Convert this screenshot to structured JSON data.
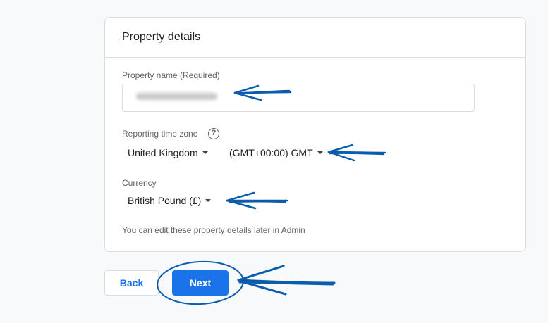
{
  "card": {
    "title": "Property details"
  },
  "property_name": {
    "label": "Property name (Required)",
    "value": ""
  },
  "time_zone": {
    "label": "Reporting time zone",
    "help_icon": "help-circle-icon",
    "country": "United Kingdom",
    "zone": "(GMT+00:00) GMT"
  },
  "currency": {
    "label": "Currency",
    "value": "British Pound (£)"
  },
  "note": "You can edit these property details later in Admin",
  "buttons": {
    "back": "Back",
    "next": "Next"
  },
  "colors": {
    "primary": "#1a73e8",
    "annotation": "#0b5cad"
  }
}
